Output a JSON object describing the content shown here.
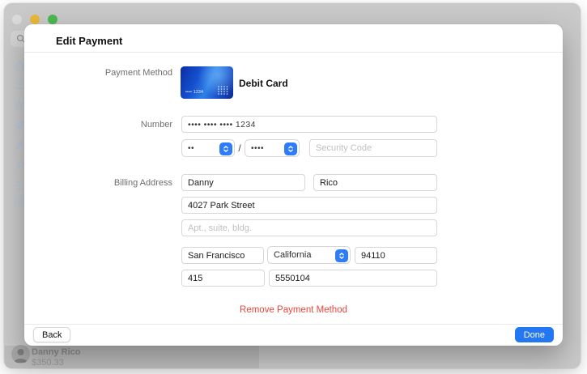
{
  "chrome": {
    "traffic_lights": {
      "close": "close-window",
      "minimize": "minimize-window",
      "zoom": "zoom-window"
    },
    "sidebar_icons": [
      "search",
      "star",
      "digital-touch",
      "origami",
      "paper-plane",
      "rocket",
      "hammer",
      "apps-grid",
      "sticker"
    ],
    "conversation": {
      "name": "Danny Rico",
      "amount": "$350.33"
    }
  },
  "modal": {
    "title": "Edit Payment",
    "payment_method": {
      "label": "Payment Method",
      "card_name": "Debit Card",
      "card_last4": "•••• 1234"
    },
    "number": {
      "label": "Number",
      "value": "•••• •••• •••• 1234"
    },
    "expiry": {
      "month": "••",
      "slash": "/",
      "year": "••••",
      "security_placeholder": "Security Code"
    },
    "billing": {
      "label": "Billing Address",
      "first_name": "Danny",
      "last_name": "Rico",
      "street": "4027 Park Street",
      "line2_placeholder": "Apt., suite, bldg.",
      "city": "San Francisco",
      "state": "California",
      "zip": "94110",
      "area_code": "415",
      "phone": "5550104"
    },
    "remove_label": "Remove Payment Method",
    "back_label": "Back",
    "done_label": "Done"
  },
  "colors": {
    "accent_blue": "#2e7df6",
    "done_blue": "#2377f2",
    "destructive_red": "#e8453c",
    "traffic_gray": "#dadada",
    "traffic_yellow": "#e9b83c",
    "traffic_green": "#4cb950",
    "window_gray": "#c9c9ca"
  }
}
